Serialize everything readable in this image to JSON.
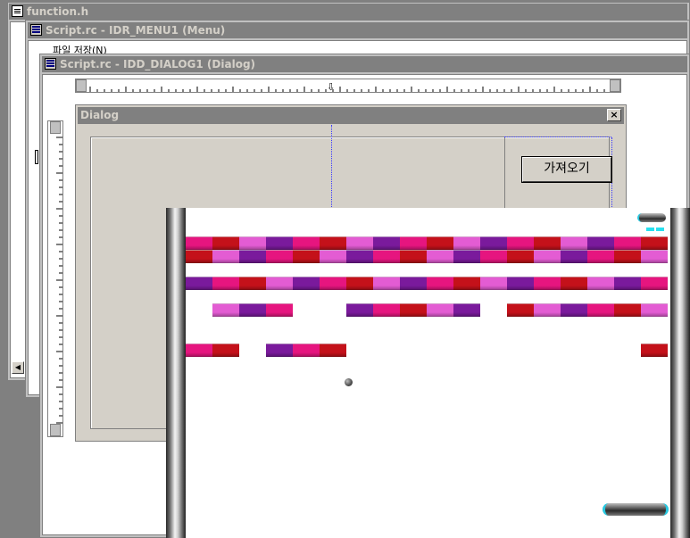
{
  "windows": {
    "function_h": {
      "title": "function.h"
    },
    "menu": {
      "title": "Script.rc - IDR_MENU1 (Menu)",
      "menu_item": "파일 저장(N)"
    },
    "dialog_editor": {
      "title": "Script.rc - IDD_DIALOG1 (Dialog)"
    }
  },
  "dialog": {
    "title": "Dialog",
    "close_label": "×",
    "fetch_button": "가져오기"
  },
  "game": {
    "brick_colors": {
      "pink": "#e6157f",
      "red": "#c4111a",
      "purple": "#7a1a9c",
      "light_pink": "#e35cd3",
      "magenta": "#c21687"
    },
    "rows": [
      [
        "pink",
        "red",
        "light_pink",
        "purple",
        "pink",
        "red",
        "light_pink",
        "purple",
        "pink",
        "red",
        "light_pink",
        "purple",
        "pink",
        "red",
        "light_pink",
        "purple",
        "pink",
        "red"
      ],
      [
        "red",
        "light_pink",
        "purple",
        "pink",
        "red",
        "light_pink",
        "purple",
        "pink",
        "red",
        "light_pink",
        "purple",
        "pink",
        "red",
        "light_pink",
        "purple",
        "pink",
        "red",
        "light_pink"
      ],
      [
        "purple",
        "pink",
        "red",
        "light_pink",
        "purple",
        "pink",
        "red",
        "light_pink",
        "purple",
        "pink",
        "red",
        "light_pink",
        "purple",
        "pink",
        "red",
        "light_pink",
        "purple",
        "pink"
      ],
      [
        null,
        "light_pink",
        "purple",
        "pink",
        null,
        null,
        "purple",
        "pink",
        "red",
        "light_pink",
        "purple",
        null,
        "red",
        "light_pink",
        "purple",
        "pink",
        "red",
        "light_pink"
      ],
      [
        "pink",
        "red",
        null,
        "purple",
        "pink",
        "red",
        null,
        null,
        null,
        null,
        null,
        null,
        null,
        null,
        null,
        null,
        null,
        "red"
      ]
    ],
    "lives_remaining": 2
  }
}
